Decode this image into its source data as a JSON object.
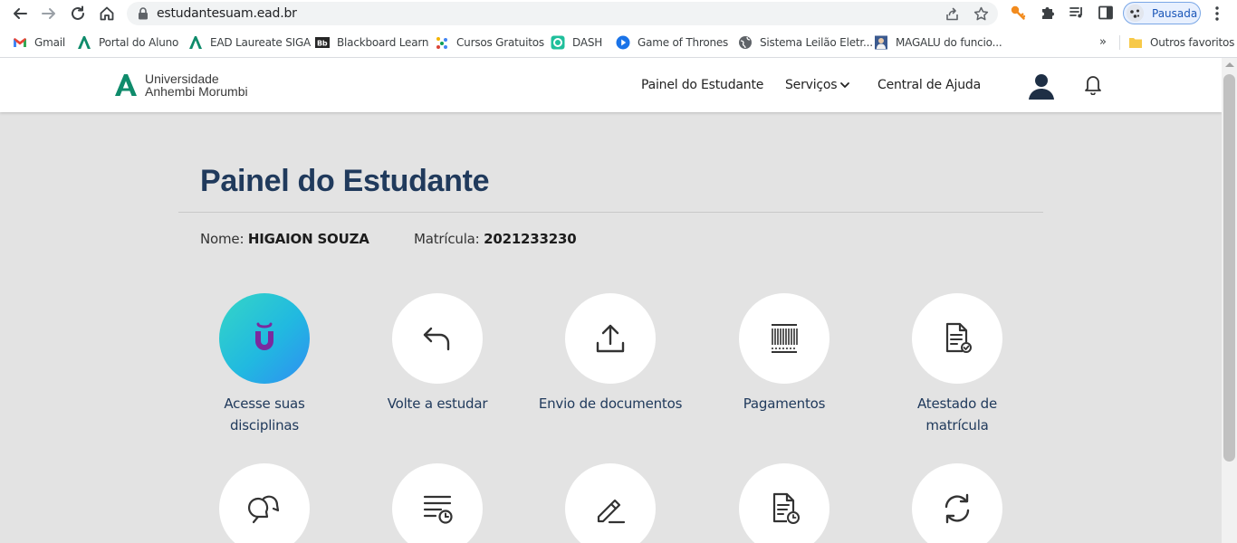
{
  "browser": {
    "url": "estudantesuam.ead.br",
    "profile_label": "Pausada",
    "bookmarks": [
      {
        "label": "Gmail",
        "icon": "gmail-icon"
      },
      {
        "label": "Portal do Aluno",
        "icon": "anhembi-logo-icon"
      },
      {
        "label": "EAD Laureate SIGA",
        "icon": "anhembi-logo-icon"
      },
      {
        "label": "Blackboard Learn",
        "icon": "blackboard-icon"
      },
      {
        "label": "Cursos Gratuitos",
        "icon": "dots-icon"
      },
      {
        "label": "DASH",
        "icon": "dash-icon"
      },
      {
        "label": "Game of Thrones",
        "icon": "play-icon"
      },
      {
        "label": "Sistema Leilão Eletr...",
        "icon": "globe-icon"
      },
      {
        "label": "MAGALU do funcio...",
        "icon": "portrait-icon"
      }
    ],
    "more_bookmarks": "»",
    "other_bookmarks": "Outros favoritos"
  },
  "header": {
    "brand_line1": "Universidade",
    "brand_line2": "Anhembi Morumbi",
    "nav": [
      "Painel do Estudante",
      "Serviços",
      "Central de Ajuda"
    ]
  },
  "page": {
    "title": "Painel do Estudante",
    "name_label": "Nome:",
    "name_value": "HIGAION SOUZA",
    "enrollment_label": "Matrícula:",
    "enrollment_value": "2021233230"
  },
  "tiles": [
    {
      "line1": "Acesse suas",
      "line2": "disciplinas",
      "icon": "ulife-icon"
    },
    {
      "line1": "Volte a estudar",
      "line2": "",
      "icon": "return-arrow-icon"
    },
    {
      "line1": "Envio de documentos",
      "line2": "",
      "icon": "upload-icon"
    },
    {
      "line1": "Pagamentos",
      "line2": "",
      "icon": "barcode-icon"
    },
    {
      "line1": "Atestado de",
      "line2": "matrícula",
      "icon": "document-check-icon"
    }
  ],
  "tiles_row2_icons": [
    "chat-bubbles-icon",
    "list-clock-icon",
    "pencil-icon",
    "document-clock-icon",
    "refresh-icon"
  ],
  "colors": {
    "title": "#203a5c",
    "brand_green": "#0f8b6b",
    "page_bg": "#e3e3e3",
    "ulife_gradient_start": "#35d6c6",
    "ulife_gradient_end": "#2f8ef2",
    "ulife_letter": "#7b2a9e"
  }
}
